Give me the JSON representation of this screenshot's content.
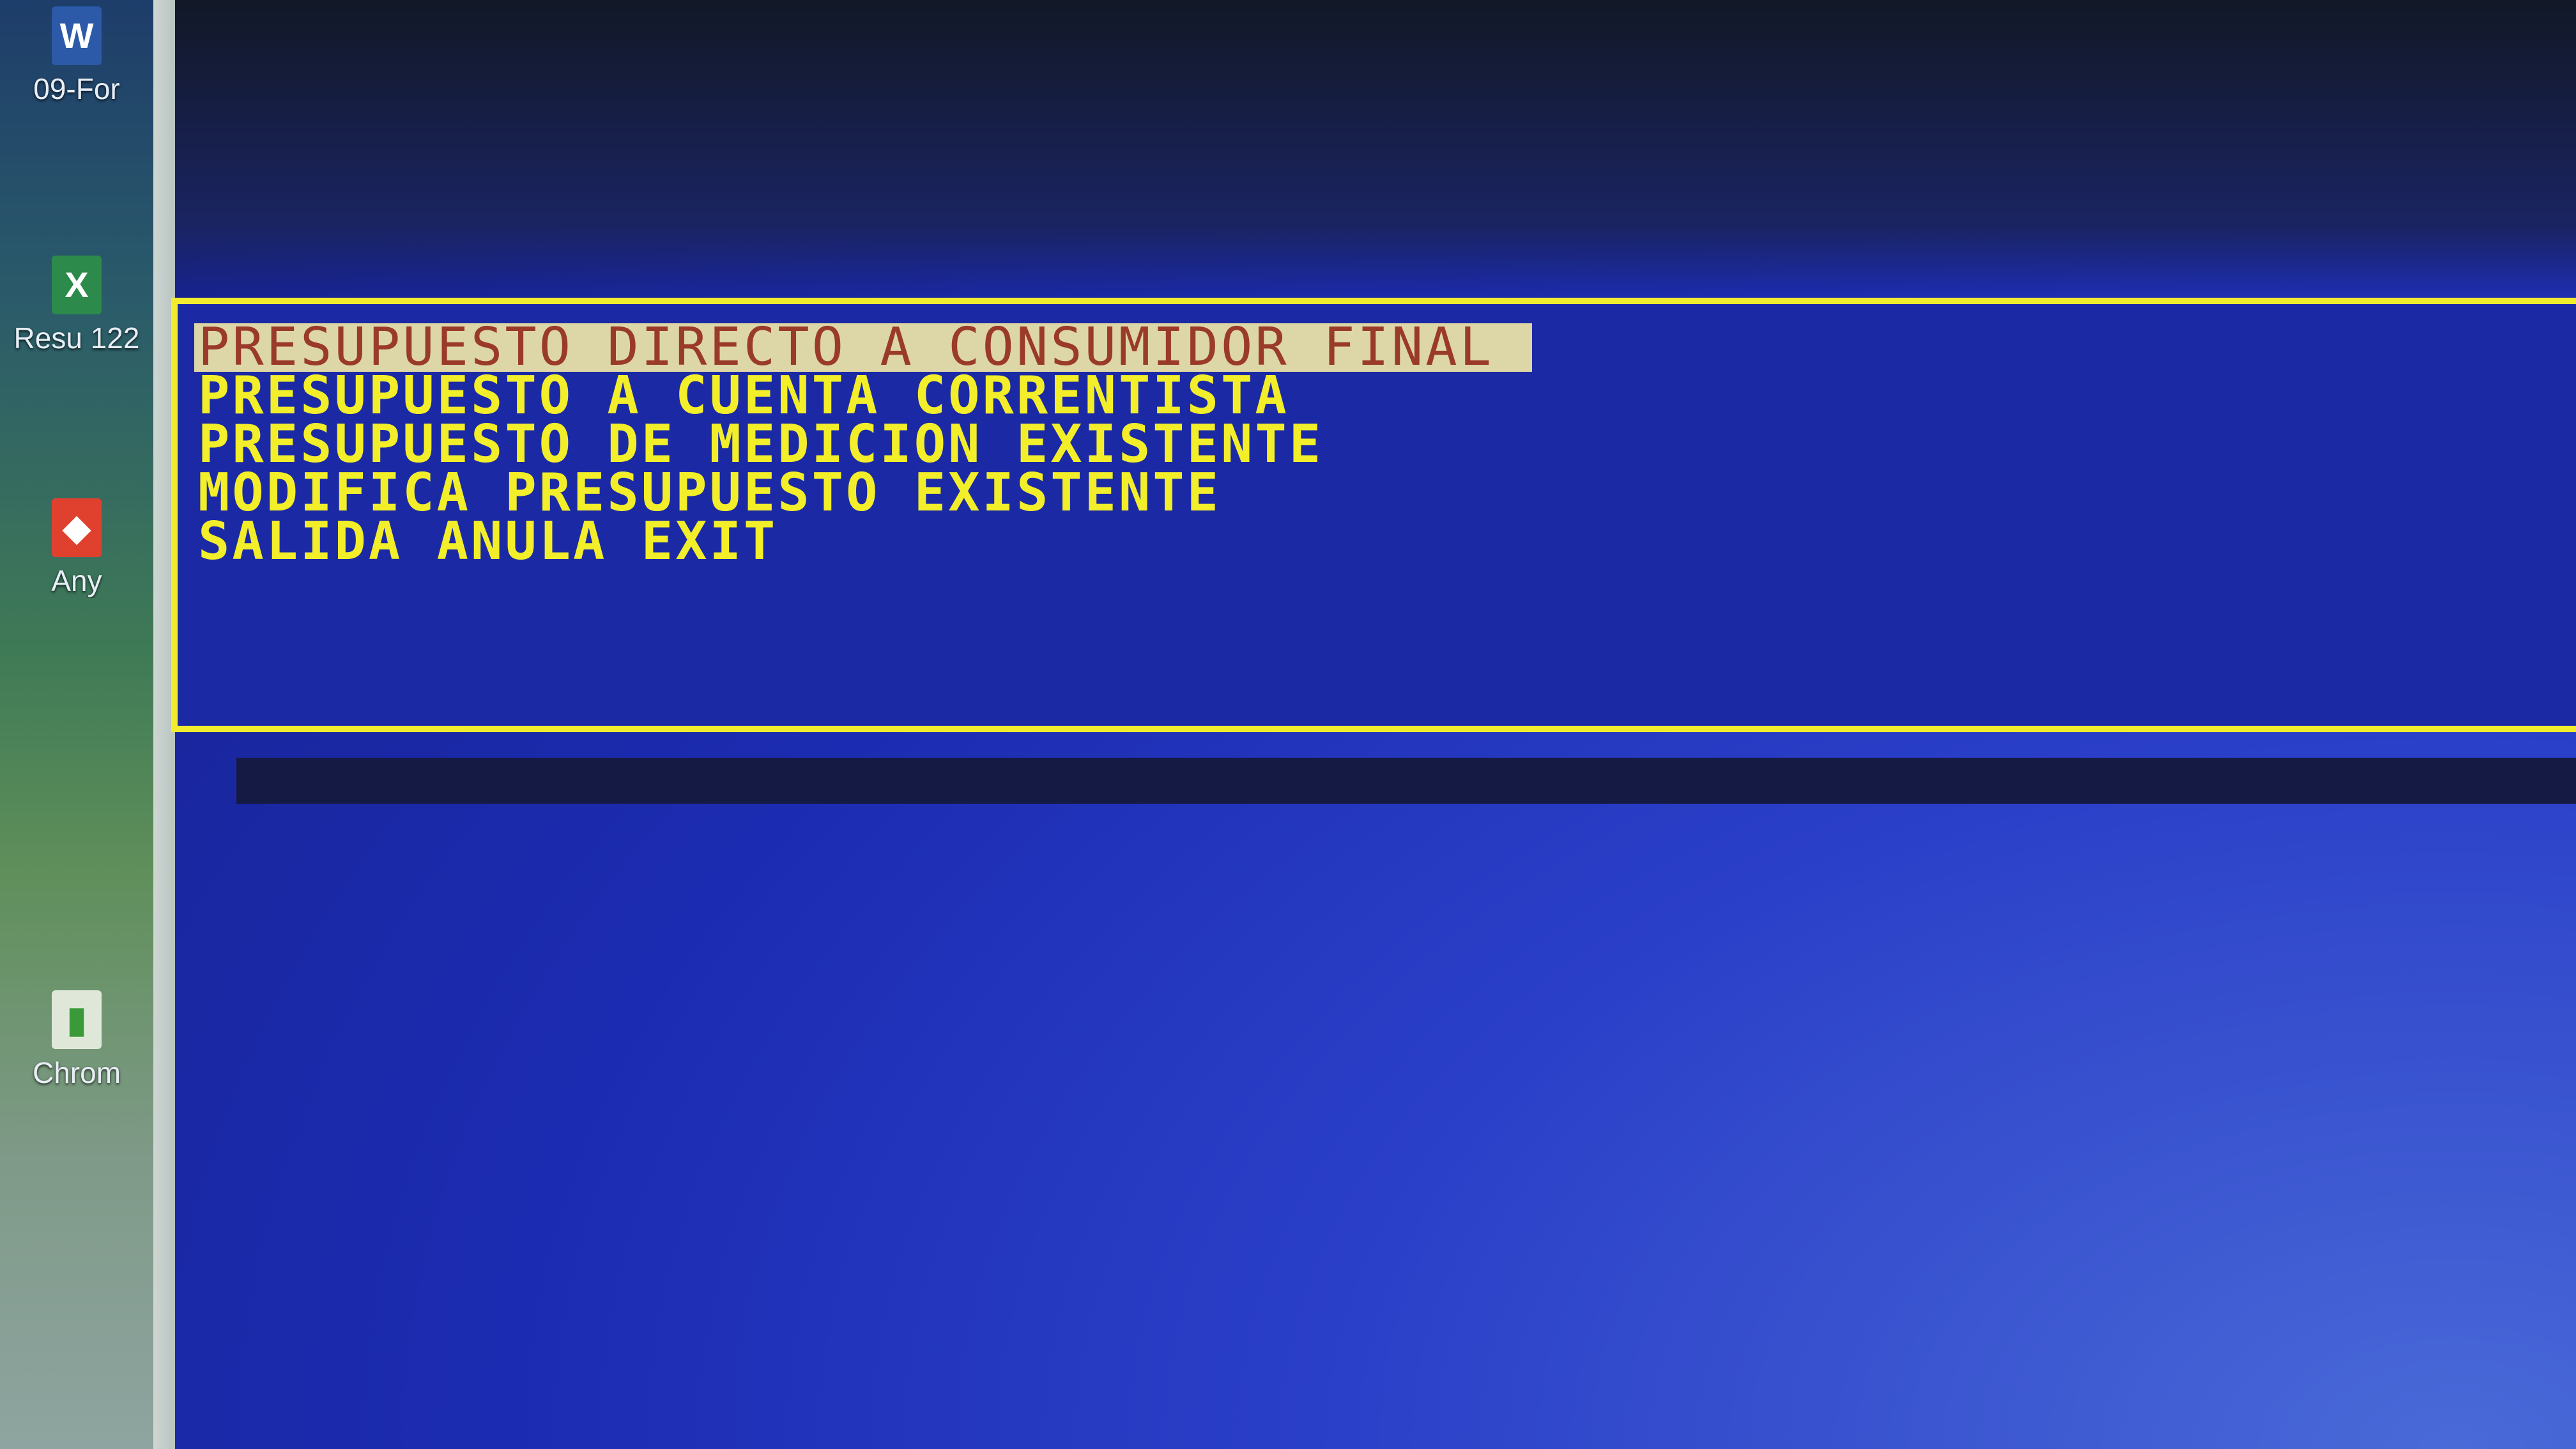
{
  "desktop": {
    "icons": [
      {
        "label": "09-For",
        "glyph": "W",
        "name": "word-document-icon"
      },
      {
        "label": "Resu 122",
        "glyph": "X",
        "name": "excel-spreadsheet-icon"
      },
      {
        "label": "Any",
        "glyph": "◆",
        "name": "anydesk-icon"
      },
      {
        "label": "Chrom",
        "glyph": "▮",
        "name": "chrome-file-icon"
      }
    ]
  },
  "menu": {
    "items": [
      {
        "label": "PRESUPUESTO DIRECTO A CONSUMIDOR FINAL",
        "selected": true
      },
      {
        "label": "PRESUPUESTO A CUENTA CORRENTISTA",
        "selected": false
      },
      {
        "label": "PRESUPUESTO DE MEDICION EXISTENTE",
        "selected": false
      },
      {
        "label": "MODIFICA PRESUPUESTO EXISTENTE",
        "selected": false
      },
      {
        "label": "SALIDA ANULA EXIT",
        "selected": false
      }
    ]
  },
  "colors": {
    "console_background": "#1b2aa4",
    "menu_border": "#f2ec2e",
    "menu_text": "#f3ee2a",
    "selected_background": "#ddd6a6",
    "selected_text": "#9a3a2a"
  }
}
